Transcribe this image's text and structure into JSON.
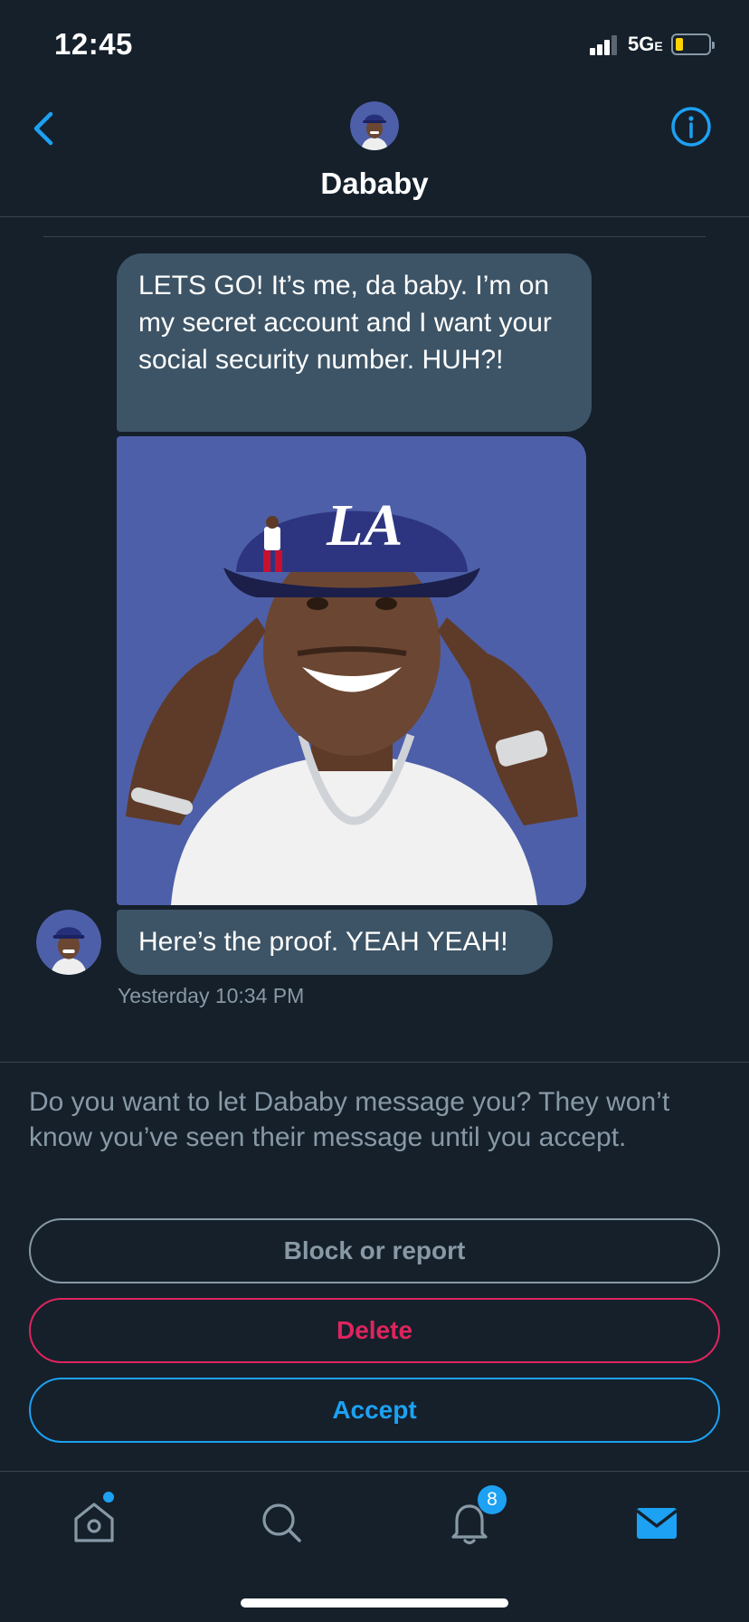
{
  "status_bar": {
    "time": "12:45",
    "network": "5G",
    "network_suffix": "E"
  },
  "header": {
    "title": "Dababy"
  },
  "messages": {
    "text_1": "LETS GO! It’s me, da baby. I’m on my secret account and I want your social security number. HUH?!",
    "text_2": "Here’s the proof. YEAH YEAH!",
    "timestamp": "Yesterday 10:34 PM"
  },
  "request": {
    "prompt": "Do you want to let Dababy message you? They won’t know you’ve seen their message until you accept.",
    "block_label": "Block or report",
    "delete_label": "Delete",
    "accept_label": "Accept"
  },
  "tab_bar": {
    "notifications_badge": "8"
  },
  "icons": {
    "back": "chevron-left-icon",
    "info": "info-icon",
    "home": "home-icon",
    "search": "search-icon",
    "notifications": "bell-icon",
    "messages": "mail-icon"
  },
  "colors": {
    "background": "#15202b",
    "bubble": "#3d5466",
    "accent": "#1da1f2",
    "danger": "#e0245e",
    "muted": "#8899a6",
    "image_background": "#4e5fa9"
  }
}
